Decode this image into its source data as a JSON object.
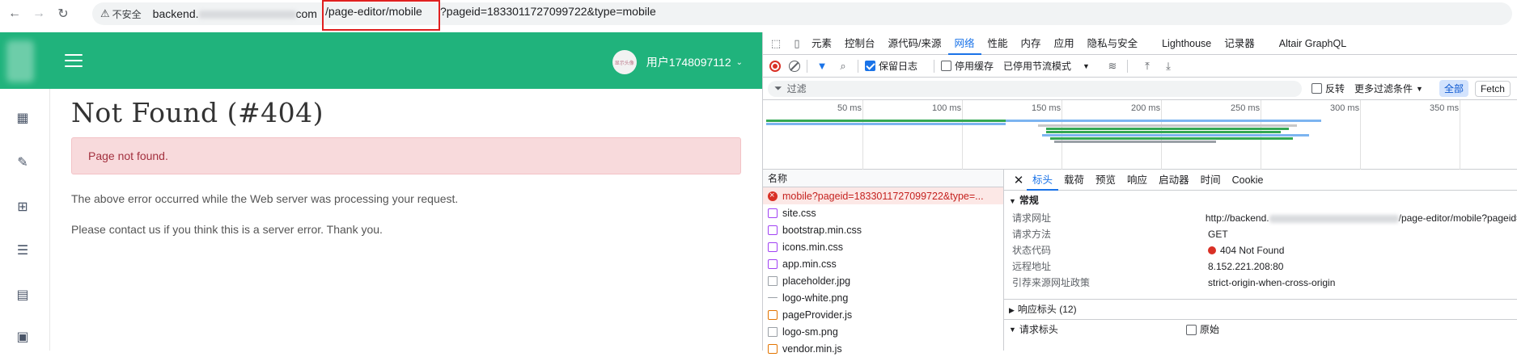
{
  "browser": {
    "security_label": "不安全",
    "url_host": "backend.",
    "url_host_tail": "com",
    "url_path": "/page-editor/mobile",
    "url_query": "?pageid=1833011727099722&type=mobile"
  },
  "app": {
    "avatar_text": "显示头像",
    "username": "用户1748097112",
    "title": "Not Found (#404)",
    "alert": "Page not found.",
    "para1": "The above error occurred while the Web server was processing your request.",
    "para2": "Please contact us if you think this is a server error. Thank you.",
    "sidebar_icons": [
      "dashboard-icon",
      "edit-icon",
      "table-icon",
      "list-icon",
      "calendar-icon",
      "clipboard-icon"
    ]
  },
  "devtools": {
    "tabs": [
      "元素",
      "控制台",
      "源代码/来源",
      "网络",
      "性能",
      "内存",
      "应用",
      "隐私与安全",
      "Lighthouse",
      "记录器",
      "Altair GraphQL"
    ],
    "active_tab": "网络",
    "preserve_log": "保留日志",
    "disable_cache": "停用缓存",
    "throttle": "已停用节流模式",
    "filter_placeholder": "过滤",
    "invert": "反转",
    "more_filters": "更多过滤条件",
    "all_chip": "全部",
    "fetch_chip": "Fetch",
    "timeline_ticks": [
      "50 ms",
      "100 ms",
      "150 ms",
      "200 ms",
      "250 ms",
      "300 ms",
      "350 ms"
    ],
    "name_header": "名称",
    "requests": [
      {
        "name": "mobile?pageid=1833011727099722&type=...",
        "kind": "err"
      },
      {
        "name": "site.css",
        "kind": "css"
      },
      {
        "name": "bootstrap.min.css",
        "kind": "css"
      },
      {
        "name": "icons.min.css",
        "kind": "css"
      },
      {
        "name": "app.min.css",
        "kind": "css"
      },
      {
        "name": "placeholder.jpg",
        "kind": "img"
      },
      {
        "name": "logo-white.png",
        "kind": "dash"
      },
      {
        "name": "pageProvider.js",
        "kind": "js"
      },
      {
        "name": "logo-sm.png",
        "kind": "img"
      },
      {
        "name": "vendor.min.js",
        "kind": "js"
      }
    ],
    "detail_tabs": [
      "标头",
      "载荷",
      "预览",
      "响应",
      "启动器",
      "时间",
      "Cookie"
    ],
    "general_title": "常规",
    "general": {
      "url_label": "请求网址",
      "url_value": "http://backend.",
      "url_value_tail": "/page-editor/mobile?pageid=",
      "method_label": "请求方法",
      "method_value": "GET",
      "status_label": "状态代码",
      "status_value": "404 Not Found",
      "remote_label": "远程地址",
      "remote_value": "8.152.221.208:80",
      "referrer_label": "引荐来源网址政策",
      "referrer_value": "strict-origin-when-cross-origin"
    },
    "response_headers": "响应标头 (12)",
    "request_headers": "请求标头",
    "raw_label": "原始"
  }
}
